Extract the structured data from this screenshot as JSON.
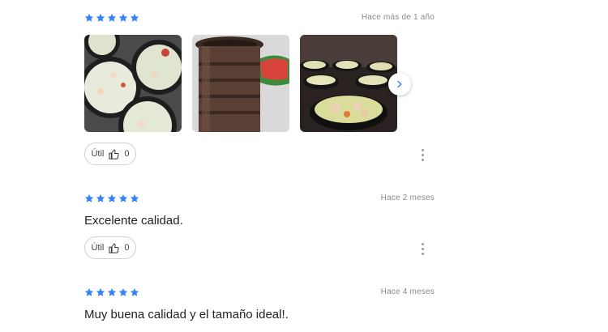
{
  "colors": {
    "star": "#3483fa",
    "date": "#8a8a8a"
  },
  "reviews": [
    {
      "rating": 5,
      "date": "Hace más de 1 año",
      "text": "",
      "useful_label": "Útil",
      "useful_count": "0",
      "photos": [
        "ceviche-bowls-photo",
        "stacked-clay-bowls-photo",
        "bowls-table-photo"
      ]
    },
    {
      "rating": 5,
      "date": "Hace 2 meses",
      "text": "Excelente calidad.",
      "useful_label": "Útil",
      "useful_count": "0"
    },
    {
      "rating": 5,
      "date": "Hace 4 meses",
      "text": "Muy buena calidad y el tamaño ideal!."
    }
  ],
  "icons": {
    "star": "star-icon",
    "thumbs_up": "thumbs-up-icon",
    "kebab": "more-options-icon",
    "next": "chevron-right-icon"
  }
}
